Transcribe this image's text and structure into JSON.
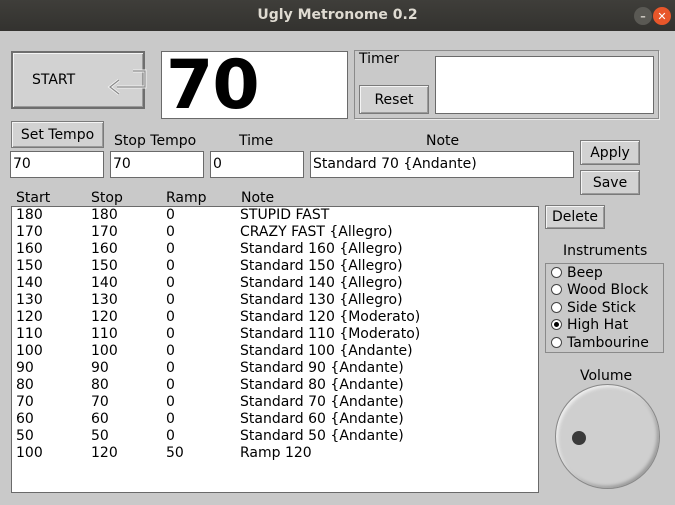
{
  "window": {
    "title": "Ugly Metronome 0.2"
  },
  "controls": {
    "start_label": "START",
    "tempo_display": "70",
    "timer_label": "Timer",
    "reset_label": "Reset",
    "timer_value": ""
  },
  "form": {
    "set_tempo_label": "Set Tempo",
    "stop_tempo_label": "Stop Tempo",
    "time_label": "Time",
    "note_label": "Note",
    "set_tempo_value": "70",
    "stop_tempo_value": "70",
    "time_value": "0",
    "note_value": "Standard 70 {Andante)",
    "apply_label": "Apply",
    "save_label": "Save"
  },
  "table": {
    "headers": [
      "Start",
      "Stop",
      "Ramp",
      "Note"
    ],
    "rows": [
      [
        "180",
        "180",
        "0",
        "STUPID FAST"
      ],
      [
        "170",
        "170",
        "0",
        "CRAZY FAST {Allegro)"
      ],
      [
        "160",
        "160",
        "0",
        "Standard 160 {Allegro)"
      ],
      [
        "150",
        "150",
        "0",
        "Standard 150 {Allegro)"
      ],
      [
        "140",
        "140",
        "0",
        "Standard 140 {Allegro)"
      ],
      [
        "130",
        "130",
        "0",
        "Standard 130 {Allegro)"
      ],
      [
        "120",
        "120",
        "0",
        "Standard 120 {Moderato)"
      ],
      [
        "110",
        "110",
        "0",
        "Standard  110 {Moderato)"
      ],
      [
        "100",
        "100",
        "0",
        "Standard  100 {Andante)"
      ],
      [
        "90",
        "90",
        "0",
        "Standard 90 {Andante)"
      ],
      [
        "80",
        "80",
        "0",
        "Standard 80 {Andante)"
      ],
      [
        "70",
        "70",
        "0",
        "Standard 70 {Andante)"
      ],
      [
        "60",
        "60",
        "0",
        "Standard 60 {Andante)"
      ],
      [
        "50",
        "50",
        "0",
        "Standard 50 {Andante)"
      ],
      [
        "100",
        "120",
        "50",
        "Ramp 120"
      ]
    ]
  },
  "sidebar": {
    "delete_label": "Delete",
    "instruments_label": "Instruments",
    "instruments": [
      {
        "label": "Beep",
        "selected": false
      },
      {
        "label": "Wood Block",
        "selected": false
      },
      {
        "label": "Side Stick",
        "selected": false
      },
      {
        "label": "High Hat",
        "selected": true
      },
      {
        "label": "Tambourine",
        "selected": false
      }
    ],
    "volume_label": "Volume"
  }
}
